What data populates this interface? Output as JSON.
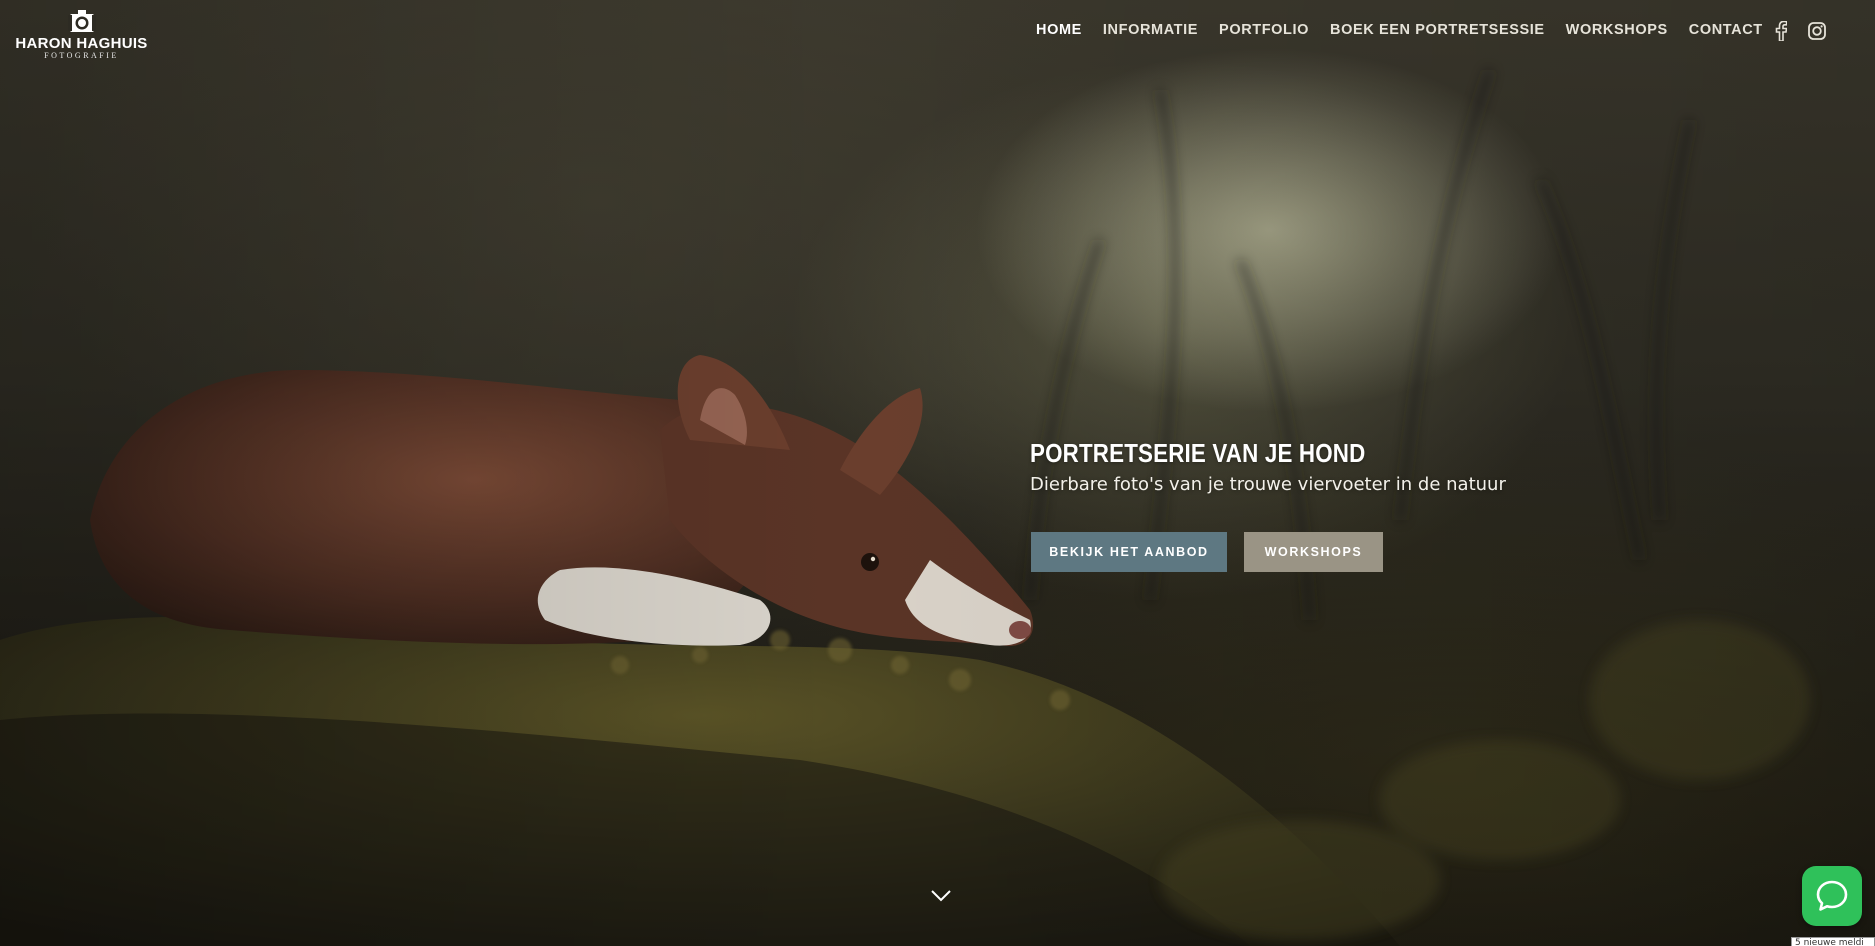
{
  "brand": {
    "name": "HARON HAGHUIS",
    "tagline": "FOTOGRAFIE",
    "logo_icon": "camera-icon"
  },
  "nav": {
    "items": [
      {
        "label": "HOME",
        "active": true
      },
      {
        "label": "INFORMATIE",
        "active": false
      },
      {
        "label": "PORTFOLIO",
        "active": false
      },
      {
        "label": "BOEK EEN PORTRETSESSIE",
        "active": false
      },
      {
        "label": "WORKSHOPS",
        "active": false
      },
      {
        "label": "CONTACT",
        "active": false
      }
    ]
  },
  "social": {
    "icons": [
      "facebook-icon",
      "instagram-icon"
    ]
  },
  "hero": {
    "title": "PORTRETSERIE VAN JE HOND",
    "subtitle": "Dierbare foto's van je trouwe viervoeter in de natuur",
    "primary_button": "BEKIJK HET AANBOD",
    "secondary_button": "WORKSHOPS",
    "scroll_icon": "chevron-down-icon"
  },
  "chat": {
    "icon": "chat-bubble-icon",
    "notice": "5 nieuwe meldi"
  },
  "colors": {
    "primary_button": "#5e7882",
    "secondary_button": "#9a9485",
    "chat_button": "#2fc15a",
    "nav_text": "#e6e3d9"
  }
}
